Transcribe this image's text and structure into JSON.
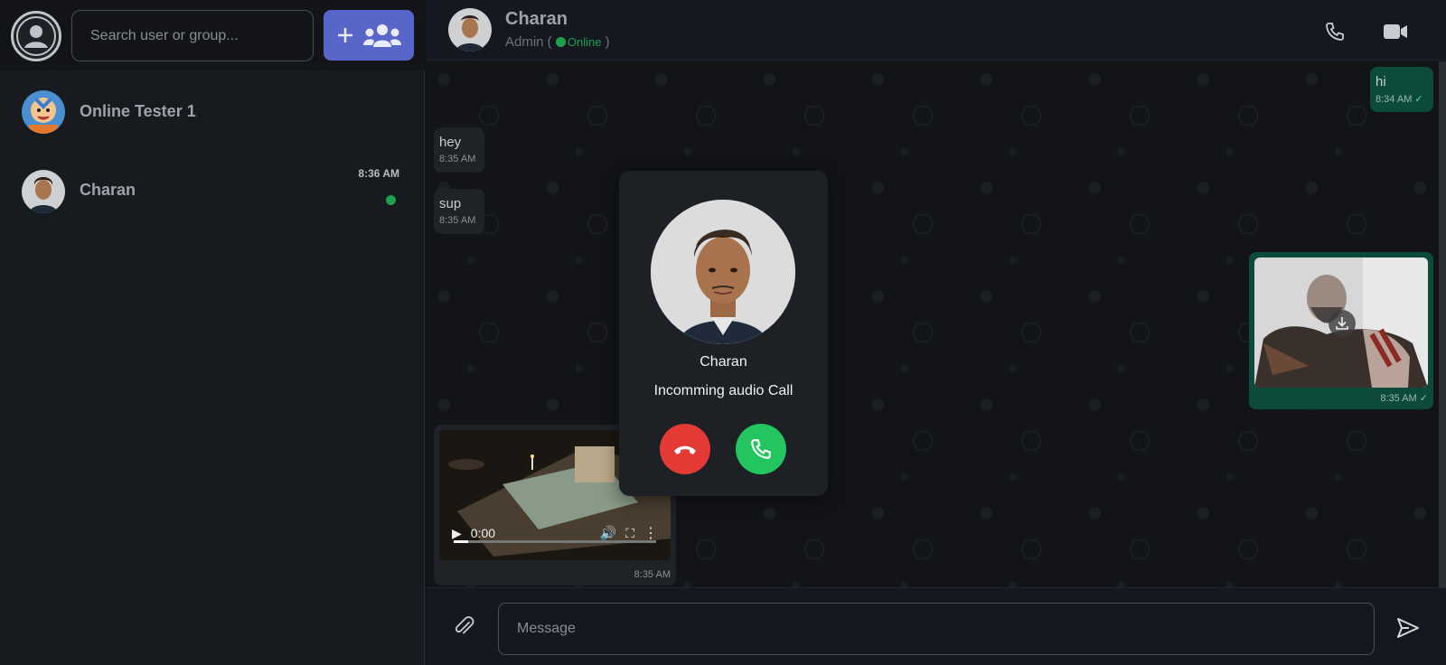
{
  "sidebar": {
    "search_placeholder": "Search user or group...",
    "chats": [
      {
        "name": "Online Tester 1",
        "time": ""
      },
      {
        "name": "Charan",
        "time": "8:36 AM"
      }
    ]
  },
  "header": {
    "name": "Charan",
    "role": "Admin (",
    "status": "Online",
    "close_paren": ")"
  },
  "messages": [
    {
      "dir": "out",
      "text": "hi",
      "time": "8:34 AM"
    },
    {
      "dir": "in",
      "text": "hey",
      "time": "8:35 AM"
    },
    {
      "dir": "in",
      "text": "sup",
      "time": "8:35 AM"
    },
    {
      "dir": "out",
      "type": "image",
      "time": "8:35 AM"
    },
    {
      "dir": "in",
      "type": "video",
      "time": "8:35 AM",
      "video_time": "0:00"
    }
  ],
  "composer": {
    "placeholder": "Message"
  },
  "call": {
    "caller": "Charan",
    "type": "Incomming audio Call"
  },
  "colors": {
    "accent": "#5865c9",
    "online": "#1da14f",
    "out_bubble": "#0c4a3c",
    "decline": "#e53935",
    "accept": "#22c55e"
  }
}
